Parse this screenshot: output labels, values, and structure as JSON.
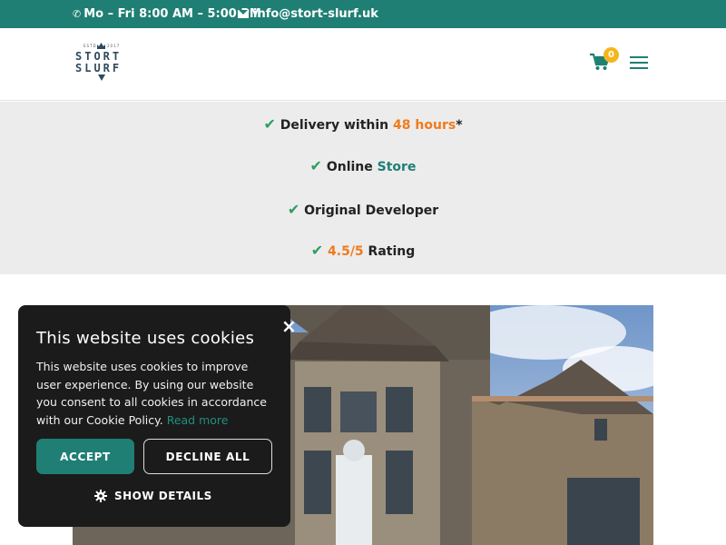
{
  "topbar": {
    "phone_icon": "phone-icon",
    "hours": "Mo – Fri 8:00 AM – 5:00 PM",
    "mail_icon": "envelope-icon",
    "email": "info@stort-slurf.uk",
    "bg_color": "#1f7f74"
  },
  "header": {
    "logo": {
      "estd_left": "ESTD",
      "estd_right": "2017",
      "line1": "STORT",
      "line2": "SLURF"
    },
    "cart": {
      "icon": "shopping-cart-icon",
      "count": "0",
      "badge_color": "#f5b51c"
    },
    "menu_icon": "hamburger-menu-icon"
  },
  "features": {
    "check_icon": "check-icon",
    "check_glyph": "✔",
    "delivery_prefix": "Delivery within ",
    "delivery_highlight": "48 hours",
    "delivery_suffix": "*",
    "online_prefix": "Online ",
    "online_highlight": "Store",
    "original": "Original Developer",
    "rating_highlight": "4.5/5",
    "rating_suffix": " Rating",
    "accent_orange": "#f07b1d",
    "accent_teal": "#1f7f74",
    "check_color": "#2e9d5f"
  },
  "hero": {
    "image": "stone-manor-house-with-bay-window-photo"
  },
  "cookie": {
    "close_glyph": "×",
    "title": "This website uses cookies",
    "body": "This website uses cookies to improve user experience. By using our website you consent to all cookies in accordance with our Cookie Policy. ",
    "read_more": "Read more",
    "accept_label": "ACCEPT",
    "decline_label": "DECLINE ALL",
    "details_label": "SHOW DETAILS",
    "gear_icon": "gear-icon",
    "bg_color": "#1b1b1b"
  }
}
